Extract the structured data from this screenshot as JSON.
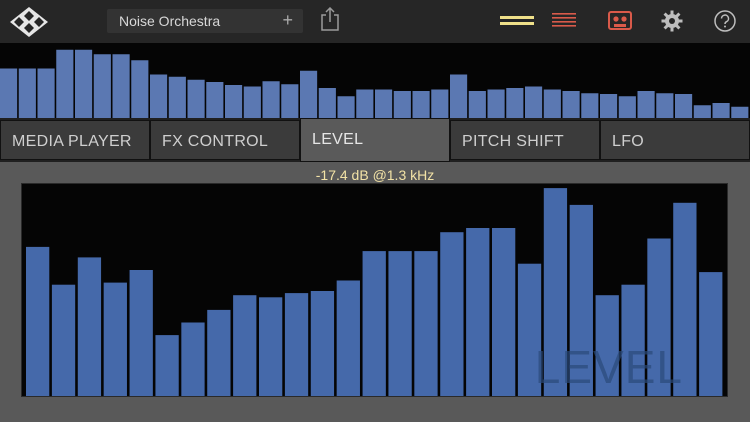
{
  "header": {
    "preset_name": "Noise Orchestra",
    "add_label": "+",
    "icons": [
      "logo-icon",
      "share-icon",
      "highlight-lines-icon",
      "list-icon",
      "tape-icon",
      "gear-icon",
      "help-icon"
    ],
    "colors": {
      "accent_yellow": "#efe08a",
      "accent_red": "#d95a4a"
    }
  },
  "overview": {
    "bar_color": "#5b78b2",
    "levels": [
      0.66,
      0.66,
      0.66,
      0.91,
      0.91,
      0.85,
      0.85,
      0.77,
      0.58,
      0.55,
      0.51,
      0.48,
      0.44,
      0.42,
      0.49,
      0.45,
      0.63,
      0.4,
      0.29,
      0.38,
      0.38,
      0.36,
      0.36,
      0.38,
      0.58,
      0.36,
      0.38,
      0.4,
      0.42,
      0.38,
      0.36,
      0.33,
      0.32,
      0.29,
      0.36,
      0.33,
      0.32,
      0.17,
      0.2,
      0.15
    ]
  },
  "tabs": [
    {
      "label": "MEDIA PLAYER",
      "active": false
    },
    {
      "label": "FX CONTROL",
      "active": false
    },
    {
      "label": "LEVEL",
      "active": true
    },
    {
      "label": "PITCH SHIFT",
      "active": false
    },
    {
      "label": "LFO",
      "active": false
    }
  ],
  "level_panel": {
    "readout": "-17.4 dB @1.3 kHz",
    "watermark": "LEVEL",
    "bar_color": "#4569aa",
    "levels": [
      0.71,
      0.53,
      0.66,
      0.54,
      0.6,
      0.29,
      0.35,
      0.41,
      0.48,
      0.47,
      0.49,
      0.5,
      0.55,
      0.69,
      0.69,
      0.69,
      0.78,
      0.8,
      0.8,
      0.63,
      0.99,
      0.91,
      0.48,
      0.53,
      0.75,
      0.92,
      0.59
    ]
  }
}
